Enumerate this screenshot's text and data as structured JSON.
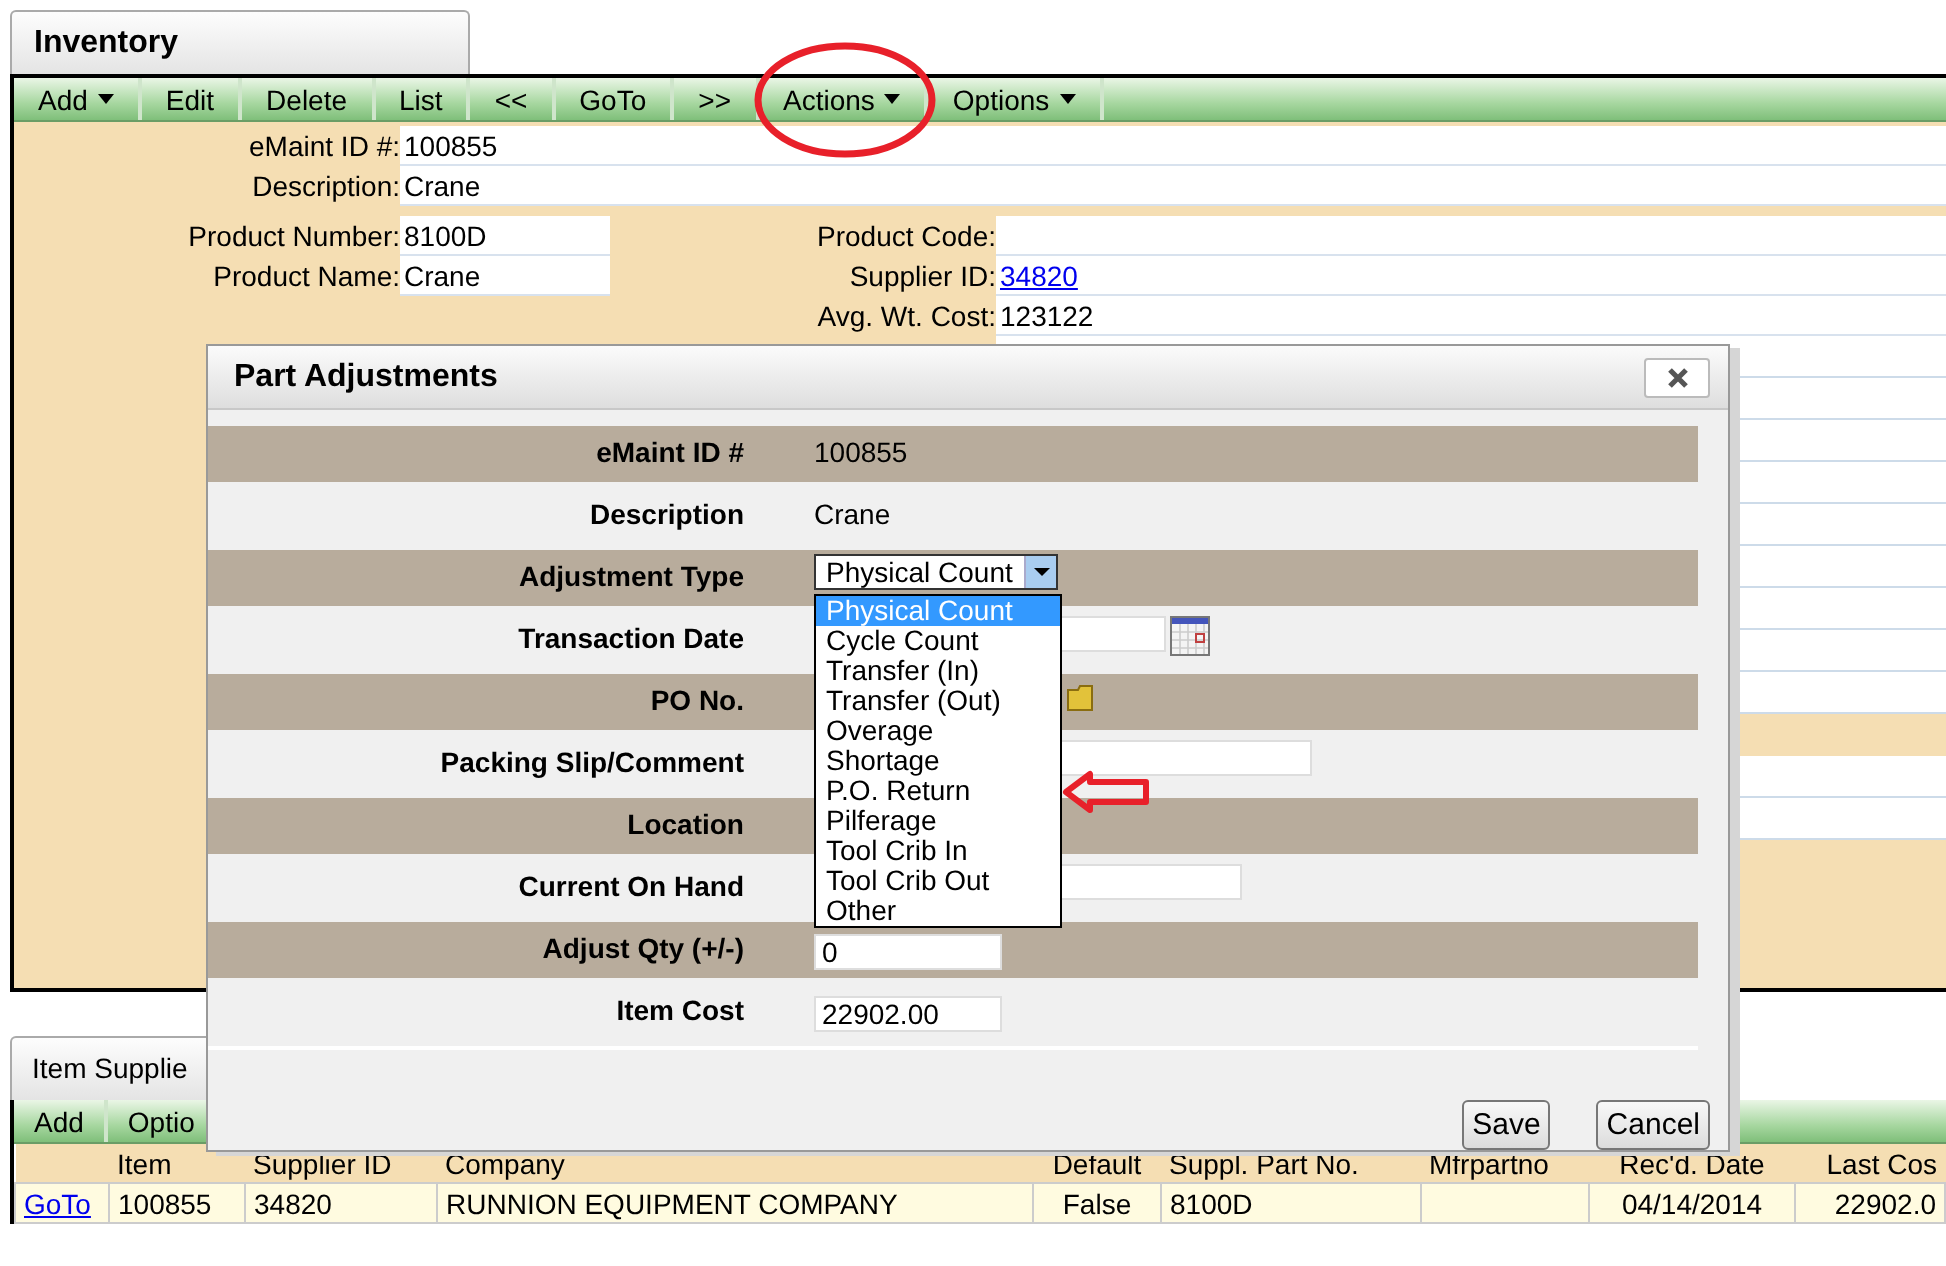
{
  "inventory_tab": {
    "title": "Inventory"
  },
  "toolbar": [
    {
      "label": "Add",
      "dropdown": true,
      "circled": false
    },
    {
      "label": "Edit",
      "dropdown": false,
      "circled": false
    },
    {
      "label": "Delete",
      "dropdown": false,
      "circled": false
    },
    {
      "label": "List",
      "dropdown": false,
      "circled": false
    },
    {
      "label": "<<",
      "dropdown": false,
      "circled": false
    },
    {
      "label": "GoTo",
      "dropdown": false,
      "circled": false
    },
    {
      "label": ">>",
      "dropdown": false,
      "circled": false
    },
    {
      "label": "Actions",
      "dropdown": true,
      "circled": true
    },
    {
      "label": "Options",
      "dropdown": true,
      "circled": false
    }
  ],
  "header_fields": [
    {
      "label": "eMaint ID #:",
      "value": "100855"
    },
    {
      "label": "Description:",
      "value": "Crane"
    }
  ],
  "product_left": [
    {
      "label": "Product Number:",
      "value": "8100D"
    },
    {
      "label": "Product Name:",
      "value": "Crane"
    }
  ],
  "product_right": [
    {
      "label": "Product Code:",
      "kind": "text"
    },
    {
      "label": "Supplier ID:",
      "value": "34820",
      "kind": "link"
    },
    {
      "label": "Avg. Wt. Cost:",
      "value": "123122",
      "kind": "text"
    }
  ],
  "dialog": {
    "title": "Part Adjustments",
    "rows": [
      {
        "label": "eMaint ID #",
        "kind": "text",
        "value": "100855"
      },
      {
        "label": "Description",
        "kind": "text",
        "value": "Crane"
      },
      {
        "label": "Adjustment Type",
        "kind": "select",
        "value": "Physical Count",
        "expanded": true,
        "options": [
          {
            "label": "Physical Count",
            "selected": true,
            "arrowed": false
          },
          {
            "label": "Cycle Count",
            "selected": false,
            "arrowed": false
          },
          {
            "label": "Transfer (In)",
            "selected": false,
            "arrowed": false
          },
          {
            "label": "Transfer (Out)",
            "selected": false,
            "arrowed": false
          },
          {
            "label": "Overage",
            "selected": false,
            "arrowed": false
          },
          {
            "label": "Shortage",
            "selected": false,
            "arrowed": false
          },
          {
            "label": "P.O. Return",
            "selected": false,
            "arrowed": true
          },
          {
            "label": "Pilferage",
            "selected": false,
            "arrowed": false
          },
          {
            "label": "Tool Crib In",
            "selected": false,
            "arrowed": false
          },
          {
            "label": "Tool Crib Out",
            "selected": false,
            "arrowed": false
          },
          {
            "label": "Other",
            "selected": false,
            "arrowed": false
          }
        ]
      },
      {
        "label": "Transaction Date",
        "kind": "date"
      },
      {
        "label": "PO No.",
        "kind": "lookup"
      },
      {
        "label": "Packing Slip/Comment",
        "kind": "wide_input"
      },
      {
        "label": "Location",
        "kind": "none"
      },
      {
        "label": "Current On Hand",
        "kind": "medium_input"
      },
      {
        "label": "Adjust Qty (+/-)",
        "kind": "input",
        "value": "0"
      },
      {
        "label": "Item Cost",
        "kind": "input",
        "value": "22902.00"
      }
    ],
    "buttons": [
      "Save",
      "Cancel"
    ]
  },
  "supplier_section": {
    "title": "Item Supplie",
    "toolbar": [
      "Add",
      "Optio"
    ],
    "columns": [
      "Item",
      "Supplier ID",
      "Company",
      "Default",
      "Suppl. Part No.",
      "Mfrpartno",
      "Rec'd. Date",
      "Last Cos"
    ],
    "rows": [
      {
        "link": "GoTo",
        "cells": [
          "100855",
          "34820",
          "RUNNION EQUIPMENT COMPANY",
          "False",
          "8100D",
          null,
          "04/14/2014",
          "22902.0"
        ]
      }
    ]
  }
}
